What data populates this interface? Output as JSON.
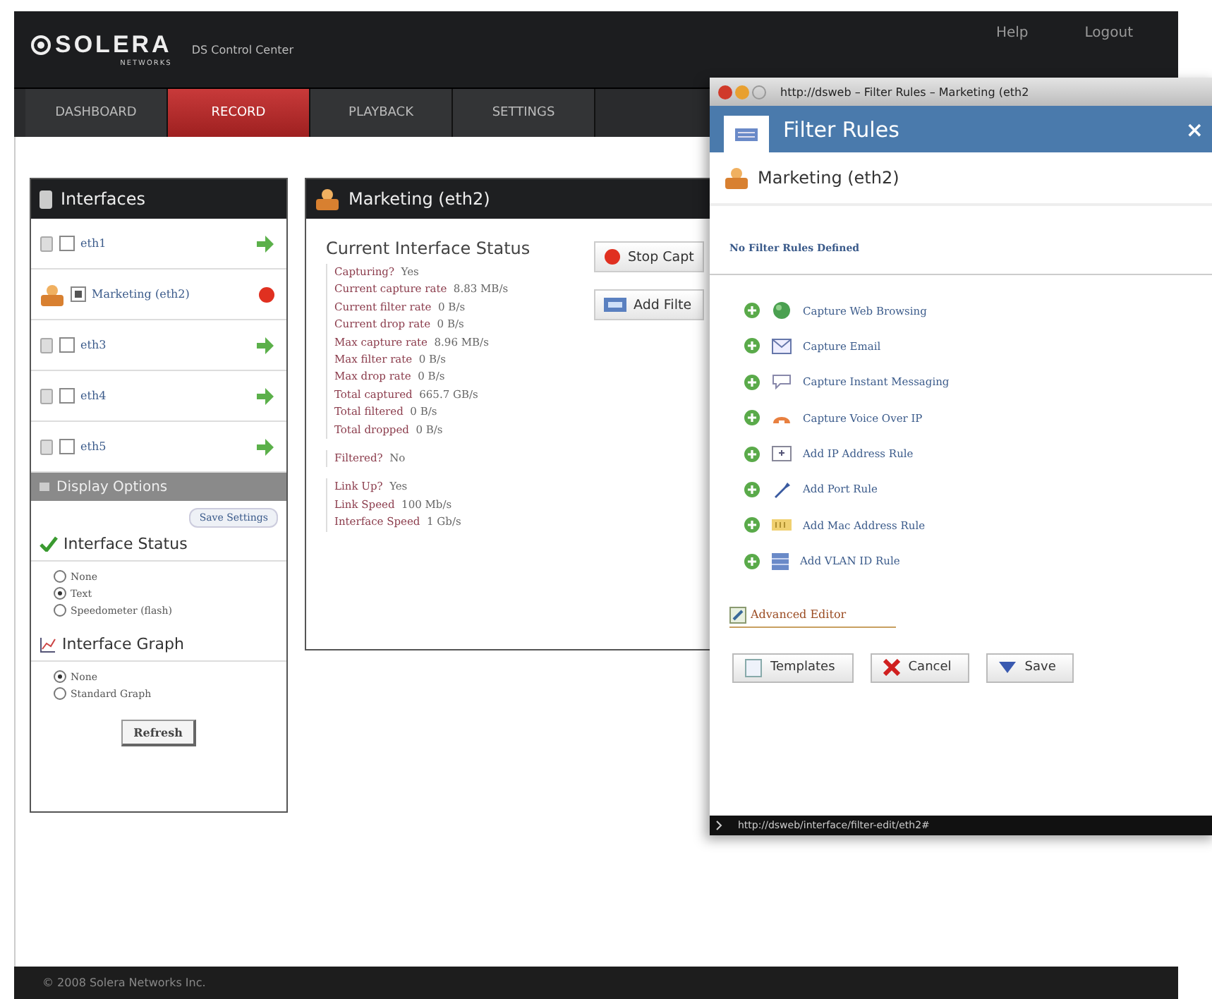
{
  "header": {
    "logo": "SOLERA",
    "logo_sub": "NETWORKS",
    "product": "DS Control Center",
    "links": [
      "Help",
      "Logout"
    ]
  },
  "nav": [
    {
      "label": "DASHBOARD",
      "selected": false
    },
    {
      "label": "RECORD",
      "selected": true
    },
    {
      "label": "PLAYBACK",
      "selected": false
    },
    {
      "label": "SETTINGS",
      "selected": false
    }
  ],
  "interfaces": {
    "title": "Interfaces",
    "items": [
      {
        "name": "eth1",
        "checked": false,
        "capturing": false
      },
      {
        "name": "Marketing (eth2)",
        "checked": true,
        "capturing": true
      },
      {
        "name": "eth3",
        "checked": false,
        "capturing": false
      },
      {
        "name": "eth4",
        "checked": false,
        "capturing": false
      },
      {
        "name": "eth5",
        "checked": false,
        "capturing": false
      }
    ]
  },
  "display_options": {
    "title": "Display Options",
    "save_button": "Save Settings",
    "groups": [
      {
        "title": "Interface Status",
        "kind": "check",
        "options": [
          {
            "label": "None",
            "selected": false
          },
          {
            "label": "Text",
            "selected": true
          },
          {
            "label": "Speedometer (flash)",
            "selected": false
          }
        ]
      },
      {
        "title": "Interface Graph",
        "kind": "graph",
        "options": [
          {
            "label": "None",
            "selected": true
          },
          {
            "label": "Standard Graph",
            "selected": false
          }
        ]
      }
    ],
    "refresh_button": "Refresh"
  },
  "detail": {
    "title": "Marketing (eth2)",
    "heading": "Current Interface Status",
    "groups": [
      [
        {
          "label": "Capturing?",
          "value": "Yes"
        },
        {
          "label": "Current capture rate",
          "value": "8.83 MB/s"
        },
        {
          "label": "Current filter rate",
          "value": "0 B/s"
        },
        {
          "label": "Current drop rate",
          "value": "0 B/s"
        },
        {
          "label": "Max capture rate",
          "value": "8.96 MB/s"
        },
        {
          "label": "Max filter rate",
          "value": "0 B/s"
        },
        {
          "label": "Max drop rate",
          "value": "0 B/s"
        },
        {
          "label": "Total captured",
          "value": "665.7 GB/s"
        },
        {
          "label": "Total filtered",
          "value": "0 B/s"
        },
        {
          "label": "Total dropped",
          "value": "0 B/s"
        }
      ],
      [
        {
          "label": "Filtered?",
          "value": "No"
        }
      ],
      [
        {
          "label": "Link Up?",
          "value": "Yes"
        },
        {
          "label": "Link Speed",
          "value": "100 Mb/s"
        },
        {
          "label": "Interface Speed",
          "value": "1 Gb/s"
        }
      ]
    ],
    "buttons": [
      {
        "label": "Stop Capt",
        "kind": "stop"
      },
      {
        "label": "Add Filte",
        "kind": "filter"
      }
    ]
  },
  "popup": {
    "window_title": "http://dsweb – Filter Rules – Marketing (eth2",
    "title": "Filter Rules",
    "close": "×",
    "subtitle": "Marketing (eth2)",
    "empty_message": "No Filter Rules Defined",
    "rules": [
      {
        "label": "Capture Web Browsing",
        "kind": "web"
      },
      {
        "label": "Capture Email",
        "kind": "email"
      },
      {
        "label": "Capture Instant Messaging",
        "kind": "im"
      },
      {
        "label": "Capture Voice Over IP",
        "kind": "voip"
      },
      {
        "label": "Add IP Address Rule",
        "kind": "ip"
      },
      {
        "label": "Add Port Rule",
        "kind": "port"
      },
      {
        "label": "Add Mac Address Rule",
        "kind": "mac"
      },
      {
        "label": "Add VLAN ID Rule",
        "kind": "vlan"
      }
    ],
    "advanced_link": "Advanced Editor",
    "buttons": [
      {
        "label": "Templates",
        "kind": "templates"
      },
      {
        "label": "Cancel",
        "kind": "cancel"
      },
      {
        "label": "Save",
        "kind": "save"
      }
    ],
    "status_url": "http://dsweb/interface/filter-edit/eth2#"
  },
  "footer": "© 2008 Solera Networks Inc."
}
